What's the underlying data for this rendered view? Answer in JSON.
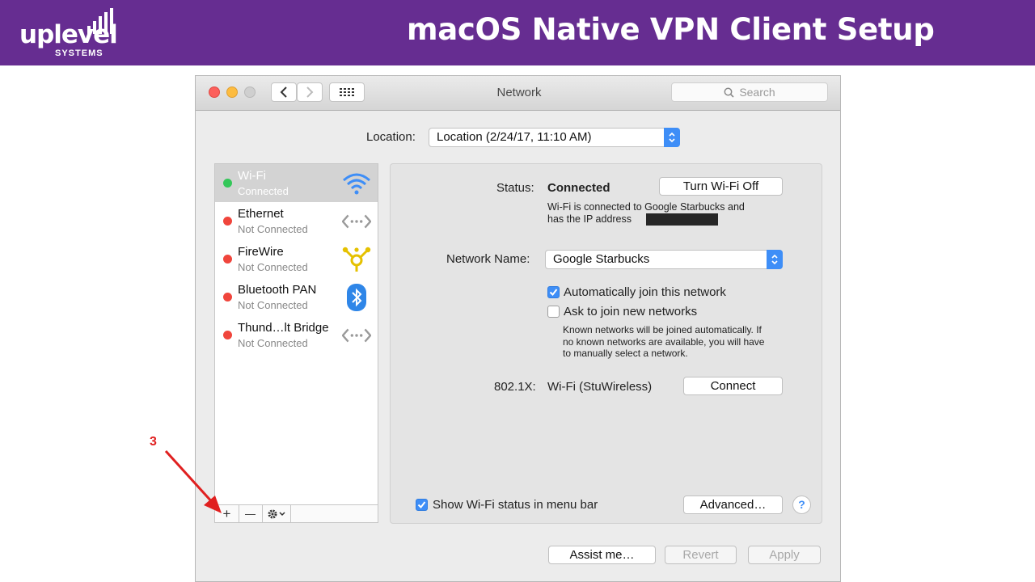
{
  "banner": {
    "title": "macOS Native VPN Client Setup",
    "logo_word": "uplevel",
    "logo_sub": "SYSTEMS",
    "brand_color": "#662d91"
  },
  "window": {
    "title": "Network",
    "search_placeholder": "Search",
    "location_label": "Location:",
    "location_value": "Location (2/24/17, 11:10 AM)"
  },
  "services": [
    {
      "name": "Wi-Fi",
      "status": "Connected",
      "dot": "#34c759",
      "icon": "wifi-icon",
      "selected": true
    },
    {
      "name": "Ethernet",
      "status": "Not Connected",
      "dot": "#f0453c",
      "icon": "ethernet-icon"
    },
    {
      "name": "FireWire",
      "status": "Not Connected",
      "dot": "#f0453c",
      "icon": "firewire-icon"
    },
    {
      "name": "Bluetooth PAN",
      "status": "Not Connected",
      "dot": "#f0453c",
      "icon": "bluetooth-icon"
    },
    {
      "name": "Thund…lt Bridge",
      "status": "Not Connected",
      "dot": "#f0453c",
      "icon": "thunderbolt-bridge-icon"
    }
  ],
  "sidebar_bar": {
    "add": "+",
    "remove": "—"
  },
  "detail": {
    "status_label": "Status:",
    "status_value": "Connected",
    "turn_off_button": "Turn Wi-Fi Off",
    "status_line1": "Wi-Fi is connected to Google Starbucks and",
    "status_line2": "has the IP address",
    "network_name_label": "Network Name:",
    "network_name_value": "Google Starbucks",
    "auto_join_label": "Automatically join this network",
    "auto_join_checked": true,
    "ask_join_label": "Ask to join new networks",
    "ask_join_checked": false,
    "hint_line1": "Known networks will be joined automatically. If",
    "hint_line2": "no known networks are available, you will have",
    "hint_line3": "to manually select a network.",
    "dot1x_label": "802.1X:",
    "dot1x_value": "Wi-Fi (StuWireless)",
    "connect_button": "Connect",
    "show_status_label": "Show Wi-Fi status in menu bar",
    "show_status_checked": true,
    "advanced_button": "Advanced…",
    "help_label": "?"
  },
  "footer": {
    "assist_button": "Assist me…",
    "revert_button": "Revert",
    "apply_button": "Apply"
  },
  "annotation": {
    "step_number": "3",
    "arrow_color": "#e02020"
  }
}
